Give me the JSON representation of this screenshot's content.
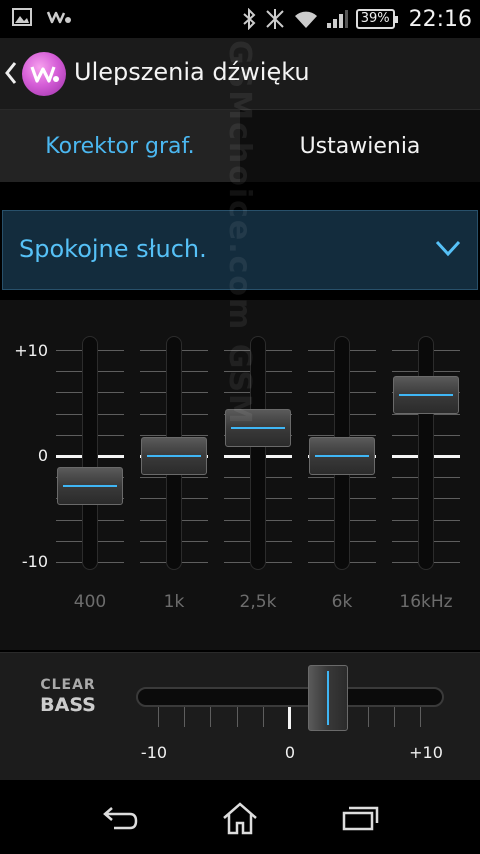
{
  "status_bar": {
    "icons_left": [
      "picture-icon",
      "walkman-icon"
    ],
    "icons_right": [
      "bluetooth-icon",
      "nfc-icon",
      "wifi-icon",
      "signal-icon"
    ],
    "battery": "39%",
    "time": "22:16"
  },
  "action_bar": {
    "title": "Ulepszenia dźwięku"
  },
  "tabs": [
    {
      "label": "Korektor graf.",
      "selected": true
    },
    {
      "label": "Ustawienia",
      "selected": false
    }
  ],
  "preset": {
    "label": "Spokojne słuch."
  },
  "equalizer": {
    "scale_top": "+10",
    "scale_mid": "0",
    "scale_bottom": "-10",
    "range": [
      -10,
      10
    ],
    "bands": [
      {
        "label": "400",
        "value": -2.8
      },
      {
        "label": "1k",
        "value": 0
      },
      {
        "label": "2,5k",
        "value": 2.6
      },
      {
        "label": "6k",
        "value": 0
      },
      {
        "label": "16kHz",
        "value": 5.8
      }
    ]
  },
  "clear_bass": {
    "logo_top": "CLEAR",
    "logo_bottom": "BASS",
    "scale_min": "-10",
    "scale_mid": "0",
    "scale_max": "+10",
    "range": [
      -10,
      10
    ],
    "value": 3
  },
  "watermark": "GSMchoice.com GSM",
  "colors": {
    "accent": "#3fb6f5",
    "tab_selected_text": "#4bb7f0",
    "preset_bg": "#132c3d"
  }
}
